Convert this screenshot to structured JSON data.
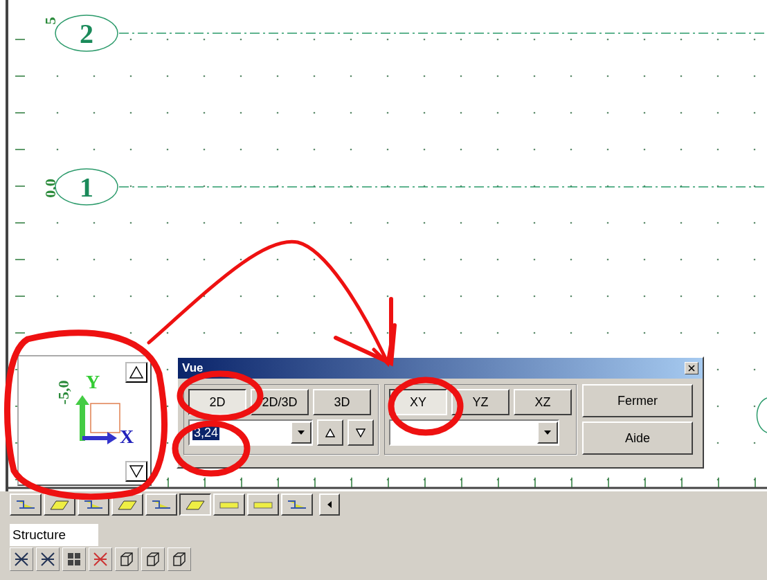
{
  "canvas": {
    "axis_labels": [
      {
        "text": "5"
      },
      {
        "text": "0,0"
      }
    ],
    "grid_lines": [
      {
        "label": "2"
      },
      {
        "label": "1"
      }
    ]
  },
  "view_navigator": {
    "axis_label": "-5,0",
    "y_label": "Y",
    "x_label": "X"
  },
  "dialog": {
    "title": "Vue",
    "mode_buttons": [
      {
        "label": "2D",
        "selected": true
      },
      {
        "label": "2D/3D",
        "selected": false
      },
      {
        "label": "3D",
        "selected": false
      }
    ],
    "zoom_combo": {
      "value": "3,24"
    },
    "plane_buttons": [
      {
        "label": "XY",
        "selected": true
      },
      {
        "label": "YZ",
        "selected": false
      },
      {
        "label": "XZ",
        "selected": false
      }
    ],
    "buttons": [
      "Fermer",
      "Aide"
    ]
  },
  "structure_field": {
    "value": "Structure"
  }
}
